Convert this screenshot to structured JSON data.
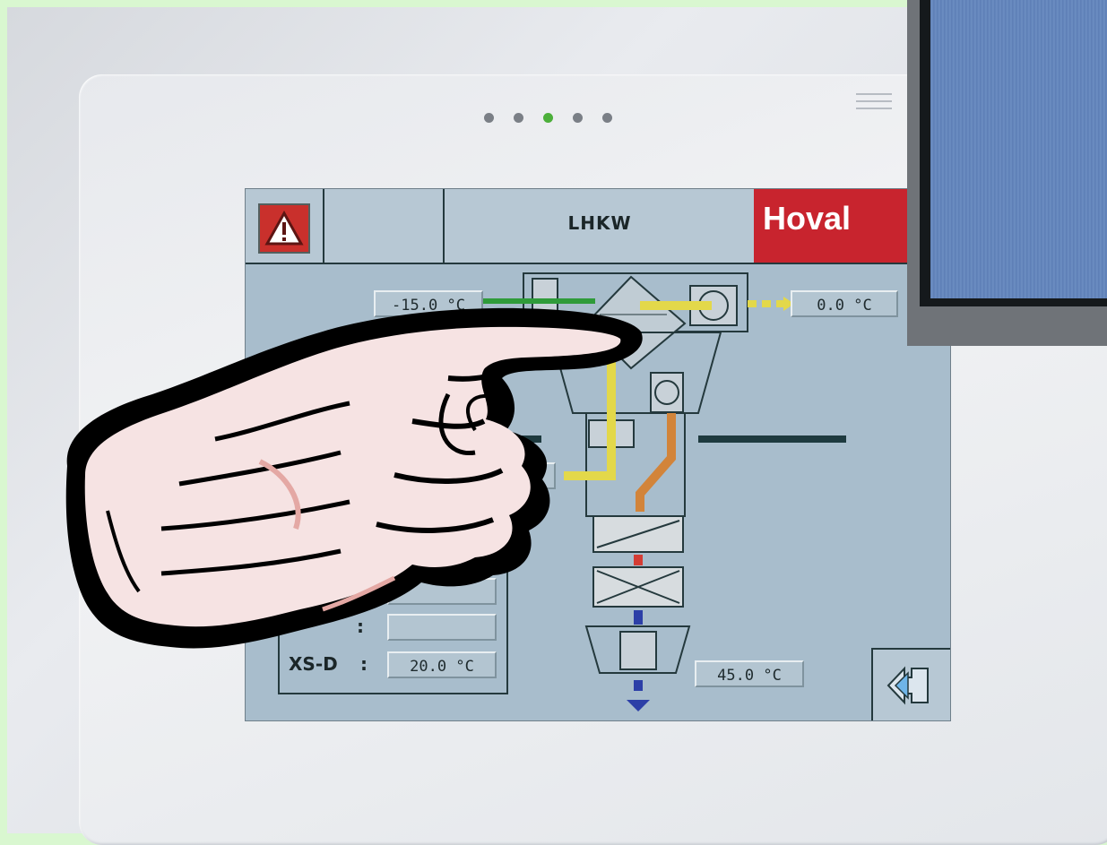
{
  "pager": {
    "count": 5,
    "active_index": 2
  },
  "screen": {
    "title": "LHKW",
    "brand": "Hoval",
    "alarm_icon": "warning-triangle-icon",
    "values": {
      "outdoor_air": "-15.0 °C",
      "supply_air": "0.0 °C",
      "mid_partial": "C",
      "bottom_right": "45.0 °C"
    },
    "panel": {
      "row3_label": "XS-D",
      "row3_sep": ":",
      "row3_value": "20.0 °C",
      "row2_sep": ":"
    },
    "back_icon": "double-arrow-left-icon"
  },
  "colors": {
    "brand_red": "#c8242e",
    "screen_bg": "#a8bdcc",
    "pager_active": "#4caf3a"
  }
}
